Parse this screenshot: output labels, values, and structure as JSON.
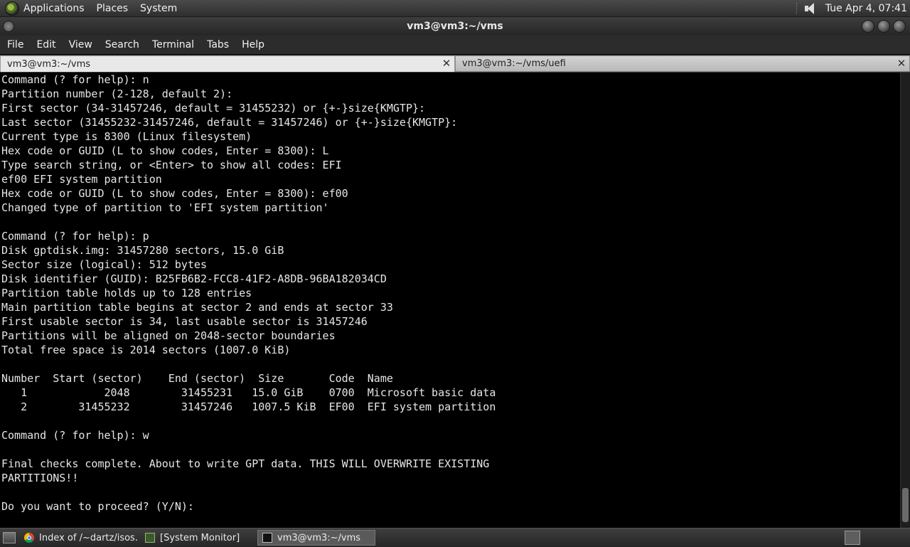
{
  "top_panel": {
    "menus": [
      "Applications",
      "Places",
      "System"
    ],
    "clock": "Tue Apr  4, 07:41",
    "icons": [
      "distro-logo-icon",
      "volume-icon"
    ]
  },
  "window": {
    "title": "vm3@vm3:~/vms"
  },
  "menubar": [
    "File",
    "Edit",
    "View",
    "Search",
    "Terminal",
    "Tabs",
    "Help"
  ],
  "tabs": [
    {
      "label": "vm3@vm3:~/vms",
      "active": true
    },
    {
      "label": "vm3@vm3:~/vms/uefi",
      "active": false
    }
  ],
  "terminal": {
    "lines": [
      "Command (? for help): n",
      "Partition number (2-128, default 2):",
      "First sector (34-31457246, default = 31455232) or {+-}size{KMGTP}:",
      "Last sector (31455232-31457246, default = 31457246) or {+-}size{KMGTP}:",
      "Current type is 8300 (Linux filesystem)",
      "Hex code or GUID (L to show codes, Enter = 8300): L",
      "Type search string, or <Enter> to show all codes: EFI",
      "ef00 EFI system partition",
      "Hex code or GUID (L to show codes, Enter = 8300): ef00",
      "Changed type of partition to 'EFI system partition'",
      "",
      "Command (? for help): p",
      "Disk gptdisk.img: 31457280 sectors, 15.0 GiB",
      "Sector size (logical): 512 bytes",
      "Disk identifier (GUID): B25FB6B2-FCC8-41F2-A8DB-96BA182034CD",
      "Partition table holds up to 128 entries",
      "Main partition table begins at sector 2 and ends at sector 33",
      "First usable sector is 34, last usable sector is 31457246",
      "Partitions will be aligned on 2048-sector boundaries",
      "Total free space is 2014 sectors (1007.0 KiB)",
      "",
      "Number  Start (sector)    End (sector)  Size       Code  Name",
      "   1            2048        31455231   15.0 GiB    0700  Microsoft basic data",
      "   2        31455232        31457246   1007.5 KiB  EF00  EFI system partition",
      "",
      "Command (? for help): w",
      "",
      "Final checks complete. About to write GPT data. THIS WILL OVERWRITE EXISTING",
      "PARTITIONS!!",
      "",
      "Do you want to proceed? (Y/N): "
    ]
  },
  "taskbar": {
    "tasks": [
      {
        "label": "Index of /~dartz/isos...",
        "icon": "chrome-icon",
        "active": false
      },
      {
        "label": "[System Monitor]",
        "icon": "system-monitor-icon",
        "active": false
      },
      {
        "label": "vm3@vm3:~/vms",
        "icon": "terminal-icon",
        "active": true
      }
    ]
  }
}
